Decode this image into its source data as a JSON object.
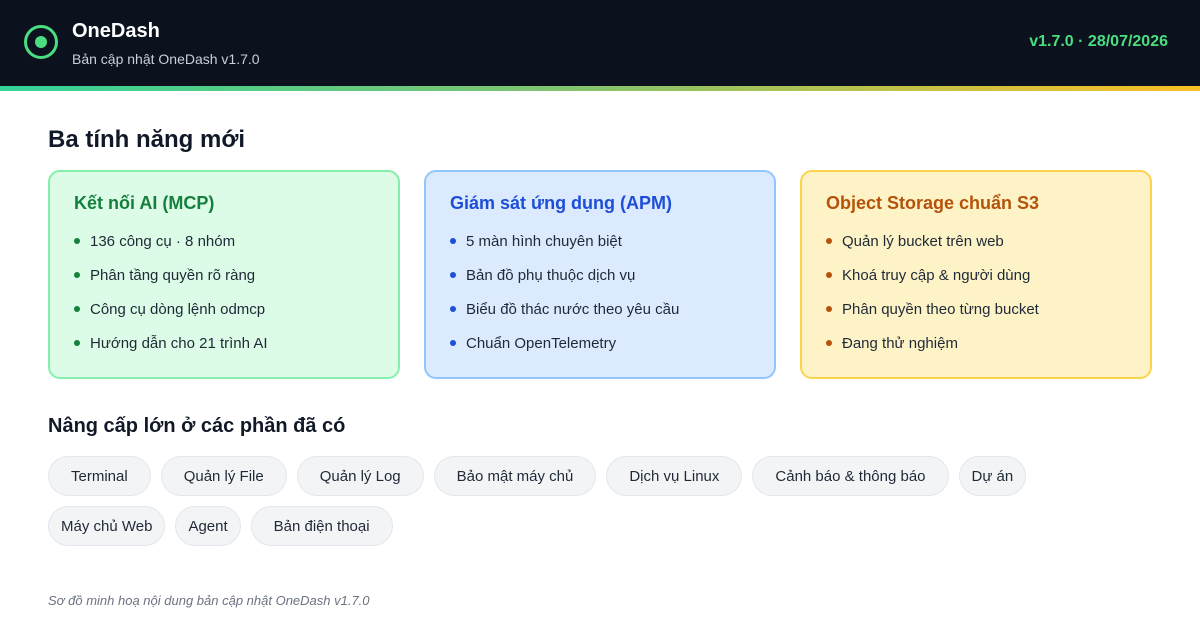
{
  "header": {
    "brand": "OneDash",
    "subtitle": "Bản cập nhật OneDash v1.7.0",
    "version": "v1.7.0 · 28/07/2026",
    "logo_icon": "target-icon",
    "accent_color": "#4ade80"
  },
  "features": {
    "heading": "Ba tính năng mới",
    "cards": [
      {
        "title": "Kết nối AI (MCP)",
        "color": "#15803d",
        "items": [
          "136 công cụ · 8 nhóm",
          "Phân tầng quyền rõ ràng",
          "Công cụ dòng lệnh odmcp",
          "Hướng dẫn cho 21 trình AI"
        ]
      },
      {
        "title": "Giám sát ứng dụng (APM)",
        "color": "#1d4ed8",
        "items": [
          "5 màn hình chuyên biệt",
          "Bản đồ phụ thuộc dịch vụ",
          "Biểu đồ thác nước theo yêu cầu",
          "Chuẩn OpenTelemetry"
        ]
      },
      {
        "title": "Object Storage chuẩn S3",
        "color": "#b45309",
        "items": [
          "Quản lý bucket trên web",
          "Khoá truy cập & người dùng",
          "Phân quyền theo từng bucket",
          "Đang thử nghiệm"
        ]
      }
    ]
  },
  "upgrades": {
    "heading": "Nâng cấp lớn ở các phần đã có",
    "chips": [
      "Terminal",
      "Quản lý File",
      "Quản lý Log",
      "Bảo mật máy chủ",
      "Dịch vụ Linux",
      "Cảnh báo & thông báo",
      "Dự án",
      "Máy chủ Web",
      "Agent",
      "Bản điện thoại"
    ]
  },
  "caption": "Sơ đồ minh hoạ nội dung bản cập nhật OneDash v1.7.0"
}
